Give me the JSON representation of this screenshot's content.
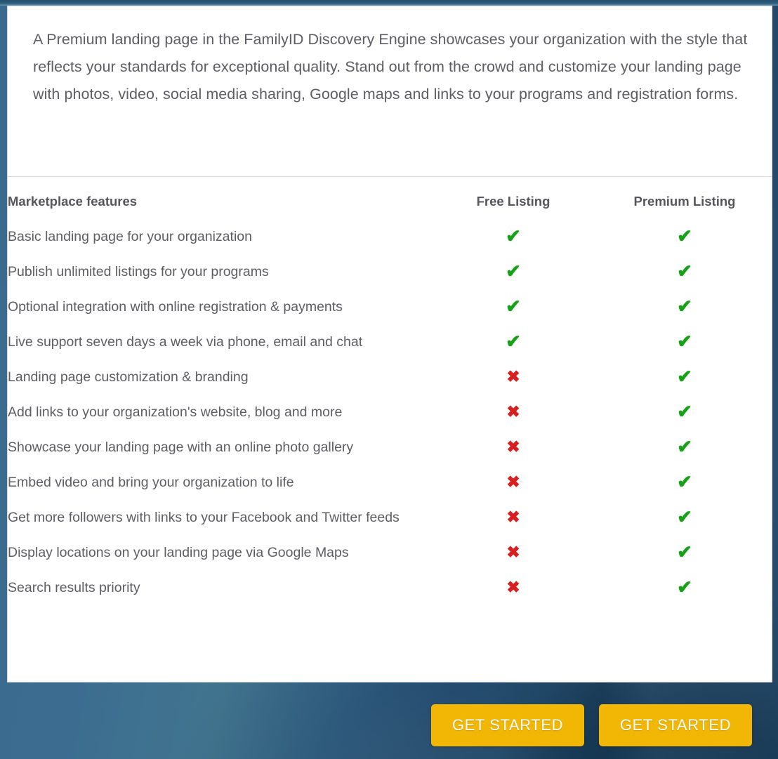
{
  "theme": {
    "accent_blue": "#2f5f83",
    "card_bg": "#ffffff",
    "cta_color": "#f2b705",
    "yes_color": "#14a314",
    "no_color": "#d91f1f",
    "text_color": "#5d5d63"
  },
  "intro": {
    "paragraph": "A Premium landing page in the FamilyID Discovery Engine showcases your organization with the style that reflects your standards for exceptional quality. Stand out from the crowd and customize your landing page with photos, video, social media sharing, Google maps and links to your programs and registration forms."
  },
  "table": {
    "headers": {
      "feature": "Marketplace features",
      "free": "Free Listing",
      "premium": "Premium Listing"
    },
    "marks": {
      "yes_glyph": "✔",
      "no_glyph": "✖",
      "yes_name": "check-icon",
      "no_name": "cross-icon"
    },
    "rows": [
      {
        "feature": "Basic landing page for your organization",
        "free": true,
        "premium": true
      },
      {
        "feature": "Publish unlimited listings for your programs",
        "free": true,
        "premium": true
      },
      {
        "feature": "Optional integration with online registration & payments",
        "free": true,
        "premium": true
      },
      {
        "feature": "Live support seven days a week via phone, email and chat",
        "free": true,
        "premium": true
      },
      {
        "feature": "Landing page customization & branding",
        "free": false,
        "premium": true
      },
      {
        "feature": "Add links to your organization's website, blog and more",
        "free": false,
        "premium": true
      },
      {
        "feature": "Showcase your landing page with an online photo gallery",
        "free": false,
        "premium": true
      },
      {
        "feature": "Embed video and bring your organization to life",
        "free": false,
        "premium": true
      },
      {
        "feature": "Get more followers with links to your Facebook and Twitter feeds",
        "free": false,
        "premium": true
      },
      {
        "feature": "Display locations on your landing page via Google Maps",
        "free": false,
        "premium": true
      },
      {
        "feature": "Search results priority",
        "free": false,
        "premium": true
      }
    ]
  },
  "footer": {
    "free_cta_label": "GET STARTED",
    "premium_cta_label": "GET STARTED"
  }
}
